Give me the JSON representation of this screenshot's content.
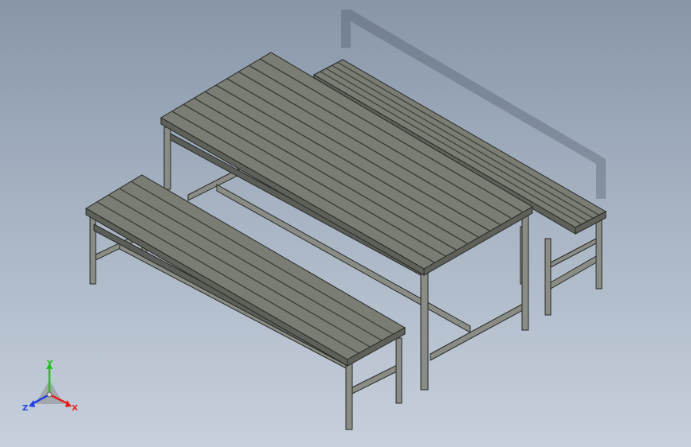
{
  "viewport": {
    "background_top": "#8896a8",
    "background_bottom": "#c7d0dc"
  },
  "model": {
    "parts": [
      "table",
      "bench-front",
      "bench-back"
    ],
    "table_slat_count": 10,
    "bench_slat_count": 5,
    "colors": {
      "slat_top": "#7a7d74",
      "slat_gap": "#3a3c38",
      "slat_edge": "#5e615a",
      "frame": "#8a8d86",
      "frame_dark": "#5b5e58",
      "outline": "#262824"
    }
  },
  "triad": {
    "x_label": "X",
    "y_label": "Y",
    "z_label": "Z",
    "x_color": "#e02020",
    "y_color": "#20c020",
    "z_color": "#2040e0",
    "icon": "view-orientation-triad-icon"
  }
}
